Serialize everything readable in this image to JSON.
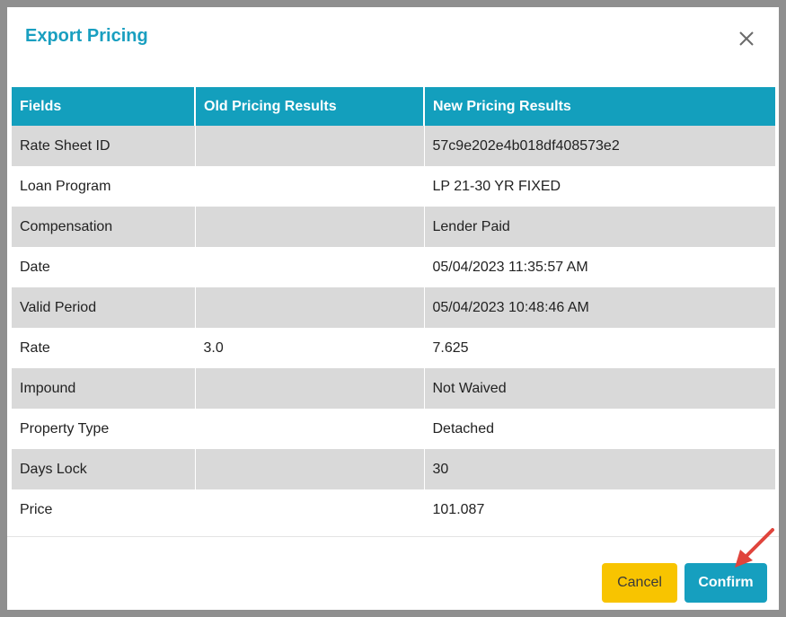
{
  "dialog": {
    "title": "Export Pricing",
    "close_icon": "close-icon"
  },
  "table": {
    "headers": [
      "Fields",
      "Old Pricing Results",
      "New Pricing Results"
    ],
    "rows": [
      {
        "field": "Rate Sheet ID",
        "old": "",
        "new": "57c9e202e4b018df408573e2"
      },
      {
        "field": "Loan Program",
        "old": "",
        "new": "LP 21-30 YR FIXED"
      },
      {
        "field": "Compensation",
        "old": "",
        "new": "Lender Paid"
      },
      {
        "field": "Date",
        "old": "",
        "new": "05/04/2023 11:35:57 AM"
      },
      {
        "field": "Valid Period",
        "old": "",
        "new": "05/04/2023 10:48:46 AM"
      },
      {
        "field": "Rate",
        "old": "3.0",
        "new": "7.625"
      },
      {
        "field": "Impound",
        "old": "",
        "new": "Not Waived"
      },
      {
        "field": "Property Type",
        "old": "",
        "new": "Detached"
      },
      {
        "field": "Days Lock",
        "old": "",
        "new": "30"
      },
      {
        "field": "Price",
        "old": "",
        "new": "101.087"
      }
    ]
  },
  "footer": {
    "cancel_label": "Cancel",
    "confirm_label": "Confirm"
  },
  "colors": {
    "accent": "#139fbd",
    "title": "#199fc0",
    "cancel": "#f8c400",
    "row_stripe": "#d9d9d9",
    "arrow": "#e0443c"
  }
}
